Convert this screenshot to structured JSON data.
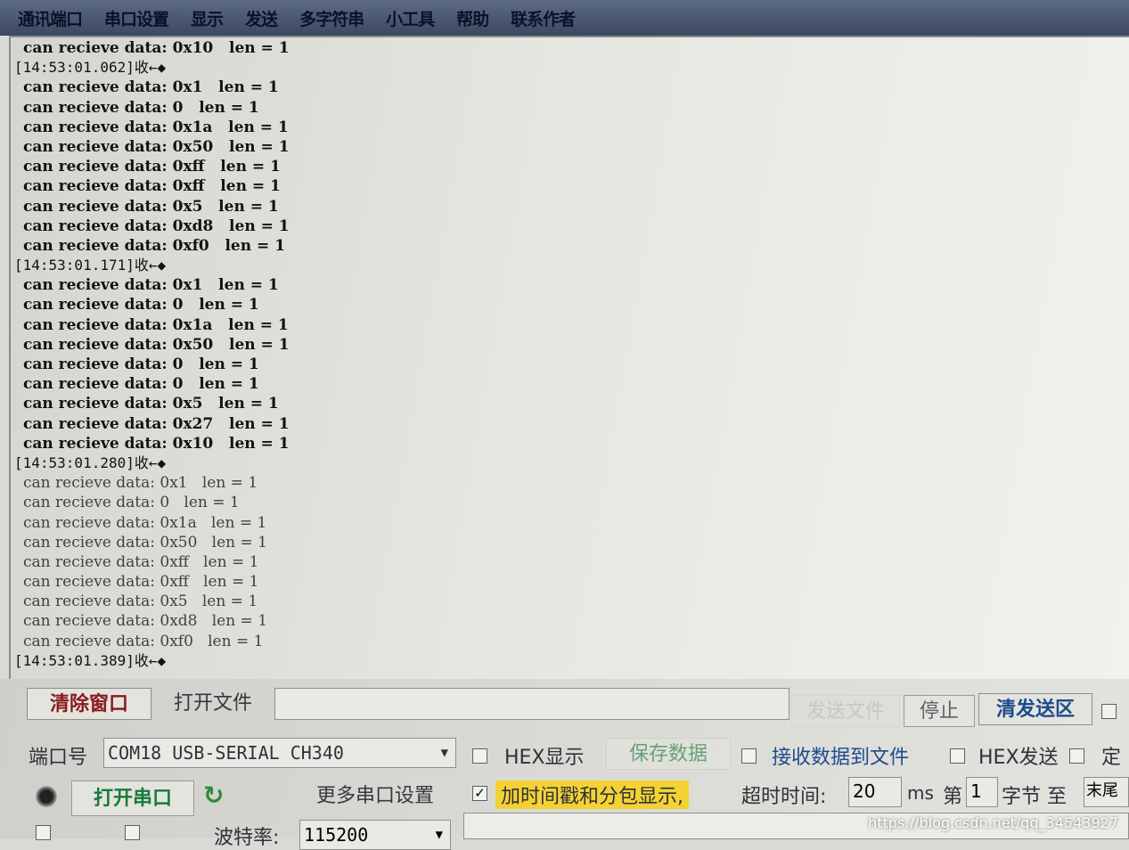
{
  "menu": [
    "通讯端口",
    "串口设置",
    "显示",
    "发送",
    "多字符串",
    "小工具",
    "帮助",
    "联系作者"
  ],
  "receive_lines": [
    {
      "type": "data",
      "text": "can recieve data: 0x10   len = 1"
    },
    {
      "type": "ts",
      "text": "[14:53:01.062]收←◆"
    },
    {
      "type": "data",
      "text": "can recieve data: 0x1   len = 1"
    },
    {
      "type": "data",
      "text": "can recieve data: 0   len = 1"
    },
    {
      "type": "data",
      "text": "can recieve data: 0x1a   len = 1"
    },
    {
      "type": "data",
      "text": "can recieve data: 0x50   len = 1"
    },
    {
      "type": "data",
      "text": "can recieve data: 0xff   len = 1"
    },
    {
      "type": "data",
      "text": "can recieve data: 0xff   len = 1"
    },
    {
      "type": "data",
      "text": "can recieve data: 0x5   len = 1"
    },
    {
      "type": "data",
      "text": "can recieve data: 0xd8   len = 1"
    },
    {
      "type": "data",
      "text": "can recieve data: 0xf0   len = 1"
    },
    {
      "type": "ts",
      "text": "[14:53:01.171]收←◆"
    },
    {
      "type": "data",
      "text": "can recieve data: 0x1   len = 1"
    },
    {
      "type": "data",
      "text": "can recieve data: 0   len = 1"
    },
    {
      "type": "data",
      "text": "can recieve data: 0x1a   len = 1"
    },
    {
      "type": "data",
      "text": "can recieve data: 0x50   len = 1"
    },
    {
      "type": "data",
      "text": "can recieve data: 0   len = 1"
    },
    {
      "type": "data",
      "text": "can recieve data: 0   len = 1"
    },
    {
      "type": "data",
      "text": "can recieve data: 0x5   len = 1"
    },
    {
      "type": "data",
      "text": "can recieve data: 0x27   len = 1"
    },
    {
      "type": "data",
      "text": "can recieve data: 0x10   len = 1"
    },
    {
      "type": "ts",
      "text": "[14:53:01.280]收←◆"
    },
    {
      "type": "data",
      "text": "can recieve data: 0x1   len = 1"
    },
    {
      "type": "data",
      "text": "can recieve data: 0   len = 1"
    },
    {
      "type": "data",
      "text": "can recieve data: 0x1a   len = 1"
    },
    {
      "type": "data",
      "text": "can recieve data: 0x50   len = 1"
    },
    {
      "type": "data",
      "text": "can recieve data: 0xff   len = 1"
    },
    {
      "type": "data",
      "text": "can recieve data: 0xff   len = 1"
    },
    {
      "type": "data",
      "text": "can recieve data: 0x5   len = 1"
    },
    {
      "type": "data",
      "text": "can recieve data: 0xd8   len = 1"
    },
    {
      "type": "data",
      "text": "can recieve data: 0xf0   len = 1"
    },
    {
      "type": "ts",
      "text": "[14:53:01.389]收←◆"
    }
  ],
  "buttons": {
    "clear_window": "清除窗口",
    "open_file": "打开文件",
    "send_file": "发送文件",
    "stop": "停止",
    "clear_send": "清发送区",
    "save_data": "保存数据",
    "open_port": "打开串口",
    "more_settings": "更多串口设置"
  },
  "port": {
    "label": "端口号",
    "value": "COM18 USB-SERIAL CH340",
    "baud_label": "波特率:",
    "baud_value": "115200"
  },
  "options": {
    "hex_display": "HEX显示",
    "recv_to_file": "接收数据到文件",
    "hex_send": "HEX发送",
    "timed_send": "定",
    "timestamp": "加时间戳和分包显示,",
    "timeout_label": "超时时间:",
    "timeout_value": "20",
    "timeout_unit": "ms",
    "nth_label": "第",
    "nth_value": "1",
    "byte_to": "字节 至",
    "end_value": "末尾"
  },
  "watermark": "https://blog.csdn.net/qq_34543927",
  "colors": {
    "menubar": "#4a5672",
    "highlight": "#f4d233",
    "refresh": "#2e8b3a"
  }
}
